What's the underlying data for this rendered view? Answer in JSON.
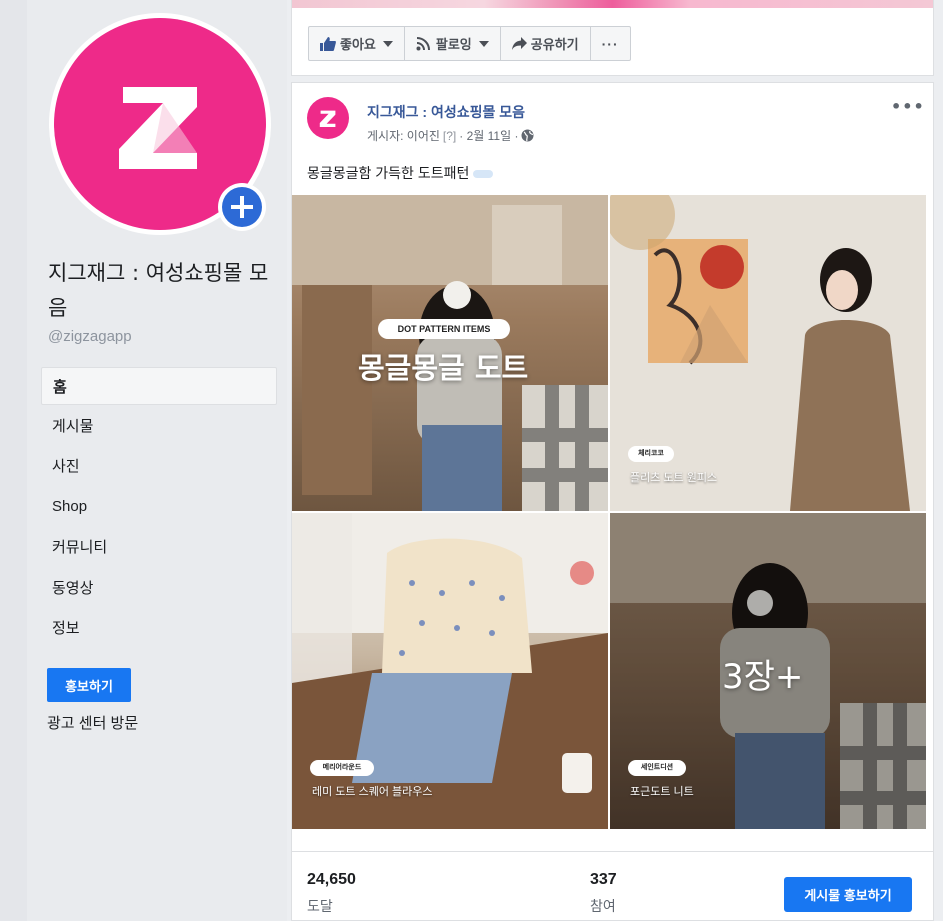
{
  "page": {
    "name": "지그재그 : 여성쇼핑몰 모음",
    "handle": "@zigzagapp",
    "logo_letter": "Z"
  },
  "sidebar": {
    "items": [
      {
        "label": "홈"
      },
      {
        "label": "게시물"
      },
      {
        "label": "사진"
      },
      {
        "label": "Shop"
      },
      {
        "label": "커뮤니티"
      },
      {
        "label": "동영상"
      },
      {
        "label": "정보"
      }
    ],
    "promote_label": "홍보하기",
    "ad_center_label": "광고 센터 방문"
  },
  "actions": {
    "like": "좋아요",
    "follow": "팔로잉",
    "share": "공유하기",
    "more": "···"
  },
  "post": {
    "author": "지그재그 : 여성쇼핑몰 모음",
    "meta_prefix": "게시자: 이어진",
    "meta_q": "[?]",
    "meta_date": "· 2월 11일 ·",
    "text": "몽글몽글함 가득한 도트패턴",
    "options": "•••",
    "photos": [
      {
        "pill": "DOT PATTERN ITEMS",
        "title": "몽글몽글 도트"
      },
      {
        "pill": "체리코코",
        "caption": "플리츠 도트 원피스"
      },
      {
        "pill": "메리어라운드",
        "caption": "레미 도트 스퀘어 블라우스"
      },
      {
        "pill": "세인트디션",
        "caption": "포근도트 니트",
        "more": "3장+"
      }
    ]
  },
  "stats": {
    "reach_value": "24,650",
    "reach_label": "도달",
    "engage_value": "337",
    "engage_label": "참여",
    "boost_label": "게시물 홍보하기"
  },
  "colors": {
    "brand_pink": "#ee2a89",
    "facebook_blue": "#1877f2",
    "link_blue": "#385898"
  }
}
